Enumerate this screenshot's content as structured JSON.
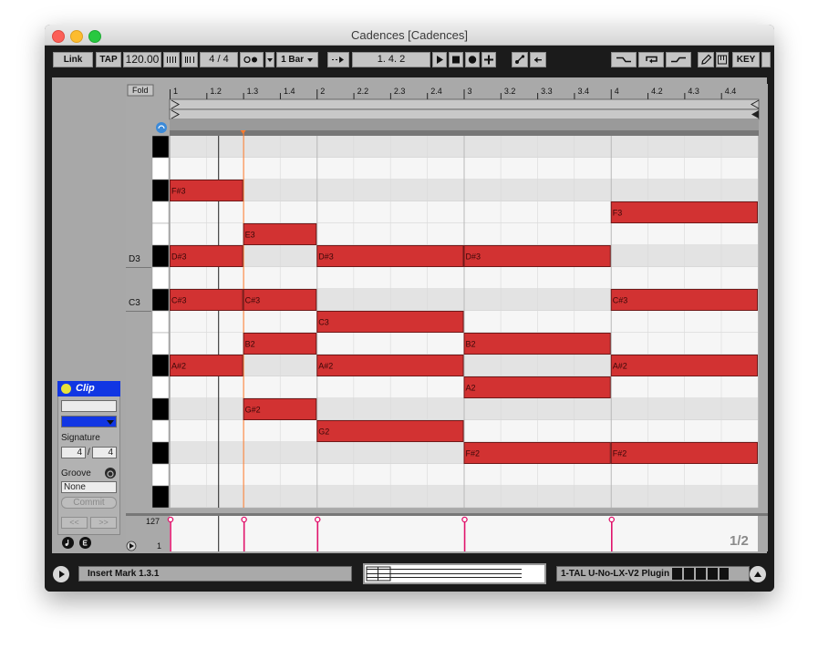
{
  "window": {
    "title": "Cadences  [Cadences]"
  },
  "toolbar": {
    "link": "Link",
    "tap": "TAP",
    "tempo": "120.00",
    "sig_num": "4",
    "sig_den": "4",
    "quant": "1 Bar",
    "position": "1.   4.   2",
    "key": "KEY"
  },
  "editor": {
    "fold": "Fold",
    "ruler": [
      "1",
      "1.2",
      "1.3",
      "1.4",
      "2",
      "2.2",
      "2.3",
      "2.4",
      "3",
      "3.2",
      "3.3",
      "3.4",
      "4",
      "4.2",
      "4.3",
      "4.4"
    ],
    "pitch_labels": [
      "D3",
      "C3"
    ],
    "velocity_top": "127",
    "velocity_bottom": "1",
    "page": "1/2",
    "notes": [
      {
        "label": "F#3",
        "row": 2,
        "start": 0,
        "dur": 2
      },
      {
        "label": "F3",
        "row": 3,
        "start": 12,
        "dur": 4
      },
      {
        "label": "E3",
        "row": 4,
        "start": 2,
        "dur": 2
      },
      {
        "label": "D#3",
        "row": 5,
        "start": 0,
        "dur": 2
      },
      {
        "label": "D#3",
        "row": 5,
        "start": 4,
        "dur": 4
      },
      {
        "label": "D#3",
        "row": 5,
        "start": 8,
        "dur": 4
      },
      {
        "label": "C#3",
        "row": 7,
        "start": 0,
        "dur": 2
      },
      {
        "label": "C#3",
        "row": 7,
        "start": 2,
        "dur": 2
      },
      {
        "label": "C#3",
        "row": 7,
        "start": 12,
        "dur": 4
      },
      {
        "label": "C3",
        "row": 8,
        "start": 4,
        "dur": 4
      },
      {
        "label": "B2",
        "row": 9,
        "start": 2,
        "dur": 2
      },
      {
        "label": "B2",
        "row": 9,
        "start": 8,
        "dur": 4
      },
      {
        "label": "A#2",
        "row": 10,
        "start": 0,
        "dur": 2
      },
      {
        "label": "A#2",
        "row": 10,
        "start": 4,
        "dur": 4
      },
      {
        "label": "A#2",
        "row": 10,
        "start": 12,
        "dur": 4
      },
      {
        "label": "A2",
        "row": 11,
        "start": 8,
        "dur": 4
      },
      {
        "label": "G#2",
        "row": 12,
        "start": 2,
        "dur": 2
      },
      {
        "label": "G2",
        "row": 13,
        "start": 4,
        "dur": 4
      },
      {
        "label": "F#2",
        "row": 14,
        "start": 8,
        "dur": 4
      },
      {
        "label": "F#2",
        "row": 14,
        "start": 12,
        "dur": 4
      }
    ],
    "velocity_markers": [
      0,
      2,
      4,
      8,
      12
    ],
    "colors": {
      "note_fill": "#d23232",
      "note_border": "#701818",
      "playhead": "#ff7a2a",
      "velocity": "#e0136b"
    }
  },
  "clip_panel": {
    "title": "Clip",
    "signature_label": "Signature",
    "sig_num": "4",
    "sig_den": "4",
    "groove_label": "Groove",
    "groove_value": "None",
    "commit": "Commit",
    "nav_left": "<<",
    "nav_right": ">>"
  },
  "status": {
    "message": "Insert Mark 1.3.1",
    "track": "1-TAL U-No-LX-V2 Plugin"
  }
}
